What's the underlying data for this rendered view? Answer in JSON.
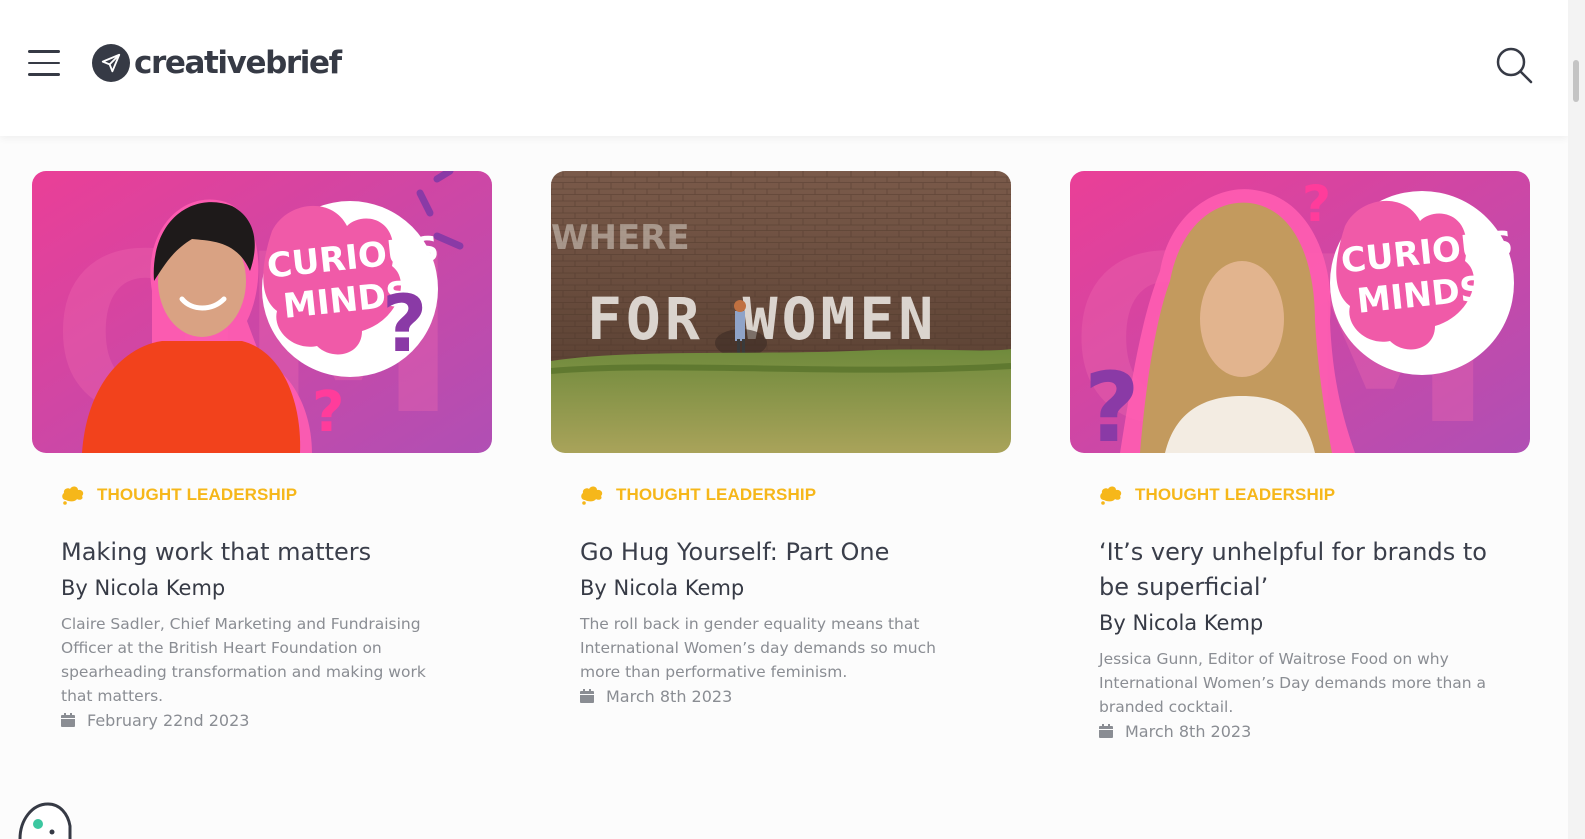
{
  "header": {
    "logo_text": "creativebrief",
    "menu_icon": "hamburger-menu-icon",
    "logo_icon": "paper-plane-icon",
    "search_icon": "search-icon"
  },
  "colors": {
    "accent": "#f6b71a",
    "text_dark": "#363a45",
    "text_muted": "#8a8d93",
    "pink": "#e8368f"
  },
  "cards": [
    {
      "image_text": "CURIOUS MINDS",
      "category": "THOUGHT LEADERSHIP",
      "title": "Making work that matters",
      "author": "By Nicola Kemp",
      "excerpt": "Claire Sadler, Chief Marketing and Fundraising Officer at the British Heart Foundation on spearheading transformation and making work that matters.",
      "date": "February 22nd 2023"
    },
    {
      "image_text": "FOR WOMEN",
      "image_text_top": "WHERE",
      "category": "THOUGHT LEADERSHIP",
      "title": "Go Hug Yourself: Part One",
      "author": "By Nicola Kemp",
      "excerpt": "The roll back in gender equality means that International Women’s day demands so much more than performative feminism.",
      "date": "March 8th 2023"
    },
    {
      "image_text": "CURIOUS MINDS",
      "category": "THOUGHT LEADERSHIP",
      "title": "‘It’s very unhelpful for brands to be superficial’",
      "author": "By Nicola Kemp",
      "excerpt": "Jessica Gunn, Editor of Waitrose Food on why International Women’s Day demands more than a branded cocktail.",
      "date": "March 8th 2023"
    }
  ]
}
